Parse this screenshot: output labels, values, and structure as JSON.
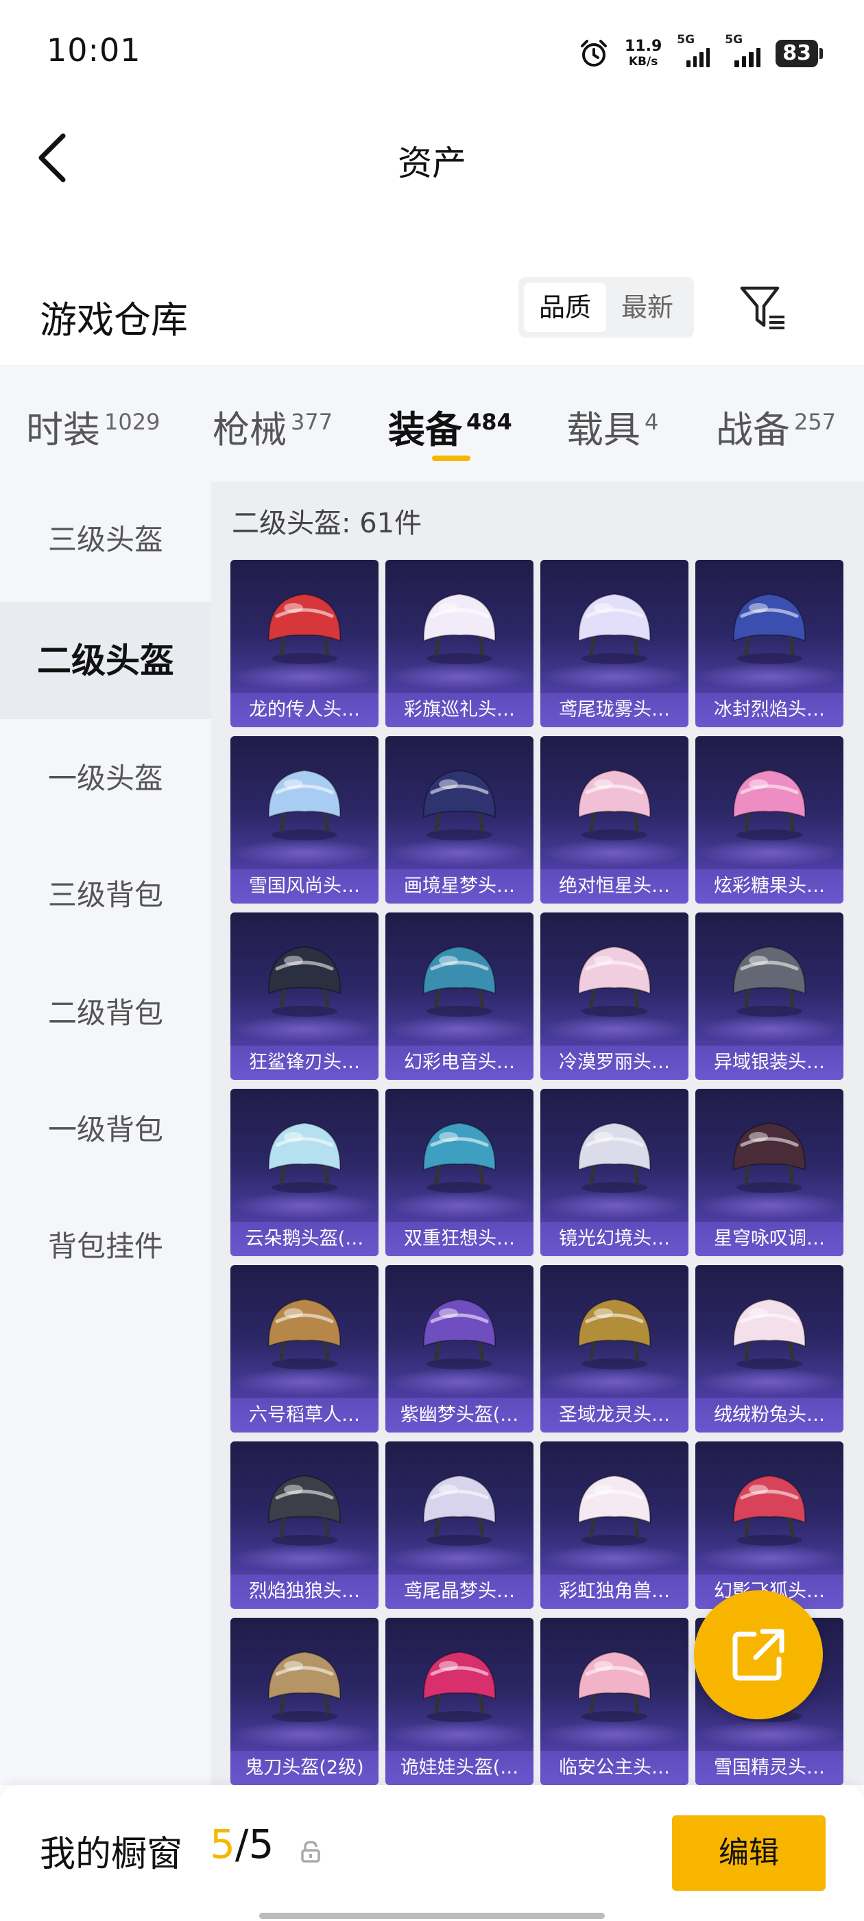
{
  "status_bar": {
    "time": "10:01",
    "net_speed": "11.9",
    "net_unit": "KB/s",
    "sim1": "5G",
    "sim2": "5G",
    "battery": "83"
  },
  "nav": {
    "title": "资产",
    "back_icon": "back-chevron-icon"
  },
  "warehouse": {
    "title": "游戏仓库",
    "sort_options": [
      "品质",
      "最新"
    ],
    "selected_sort": "品质",
    "filter_icon": "filter-icon"
  },
  "categories": [
    {
      "label": "时装",
      "count": "1029"
    },
    {
      "label": "枪械",
      "count": "377"
    },
    {
      "label": "装备",
      "count": "484"
    },
    {
      "label": "载具",
      "count": "4"
    },
    {
      "label": "战备",
      "count": "257"
    }
  ],
  "active_category": "装备",
  "sidebar": {
    "items": [
      "三级头盔",
      "二级头盔",
      "一级头盔",
      "三级背包",
      "二级背包",
      "一级背包",
      "背包挂件"
    ],
    "active": "二级头盔"
  },
  "content": {
    "header": "二级头盔: 61件",
    "items": [
      {
        "name": "龙的传人头…",
        "color": "#d7373a"
      },
      {
        "name": "彩旗巡礼头…",
        "color": "#f2ecf8"
      },
      {
        "name": "鸢尾珑雾头…",
        "color": "#e3defa"
      },
      {
        "name": "冰封烈焰头…",
        "color": "#3b4fb0"
      },
      {
        "name": "雪国风尚头…",
        "color": "#a9cdf2"
      },
      {
        "name": "画境星梦头…",
        "color": "#2d3470"
      },
      {
        "name": "绝对恒星头…",
        "color": "#f2c0d6"
      },
      {
        "name": "炫彩糖果头…",
        "color": "#ee8dc4"
      },
      {
        "name": "狂鲨锋刃头…",
        "color": "#2a3040"
      },
      {
        "name": "幻彩电音头…",
        "color": "#3a8fb0"
      },
      {
        "name": "冷漠罗丽头…",
        "color": "#f1cde0"
      },
      {
        "name": "异域银装头…",
        "color": "#646874"
      },
      {
        "name": "云朵鹅头盔(…",
        "color": "#b5e0f0"
      },
      {
        "name": "双重狂想头…",
        "color": "#3e9fc0"
      },
      {
        "name": "镜光幻境头…",
        "color": "#dcdbea"
      },
      {
        "name": "星穹咏叹调…",
        "color": "#4a2c38"
      },
      {
        "name": "六号稻草人…",
        "color": "#b7874a"
      },
      {
        "name": "紫幽梦头盔(…",
        "color": "#6f4ec0"
      },
      {
        "name": "圣域龙灵头…",
        "color": "#b38e3a"
      },
      {
        "name": "绒绒粉兔头…",
        "color": "#f3e0ea"
      },
      {
        "name": "烈焰独狼头…",
        "color": "#3c3e48"
      },
      {
        "name": "鸢尾晶梦头…",
        "color": "#d8d4ee"
      },
      {
        "name": "彩虹独角兽…",
        "color": "#f5eaf1"
      },
      {
        "name": "幻影飞狐头…",
        "color": "#d8435a"
      },
      {
        "name": "鬼刀头盔(2级)",
        "color": "#b59466"
      },
      {
        "name": "诡娃娃头盔(…",
        "color": "#d8306c"
      },
      {
        "name": "临安公主头…",
        "color": "#f2b3c8"
      },
      {
        "name": "雪国精灵头…",
        "color": "#c3dcef"
      }
    ]
  },
  "fab": {
    "icon": "share-external-icon",
    "color": "#f7b500"
  },
  "bottom_bar": {
    "title": "我的橱窗",
    "current": "5",
    "separator": "/",
    "total": "5",
    "lock_icon": "lock-icon",
    "edit_label": "编辑"
  }
}
